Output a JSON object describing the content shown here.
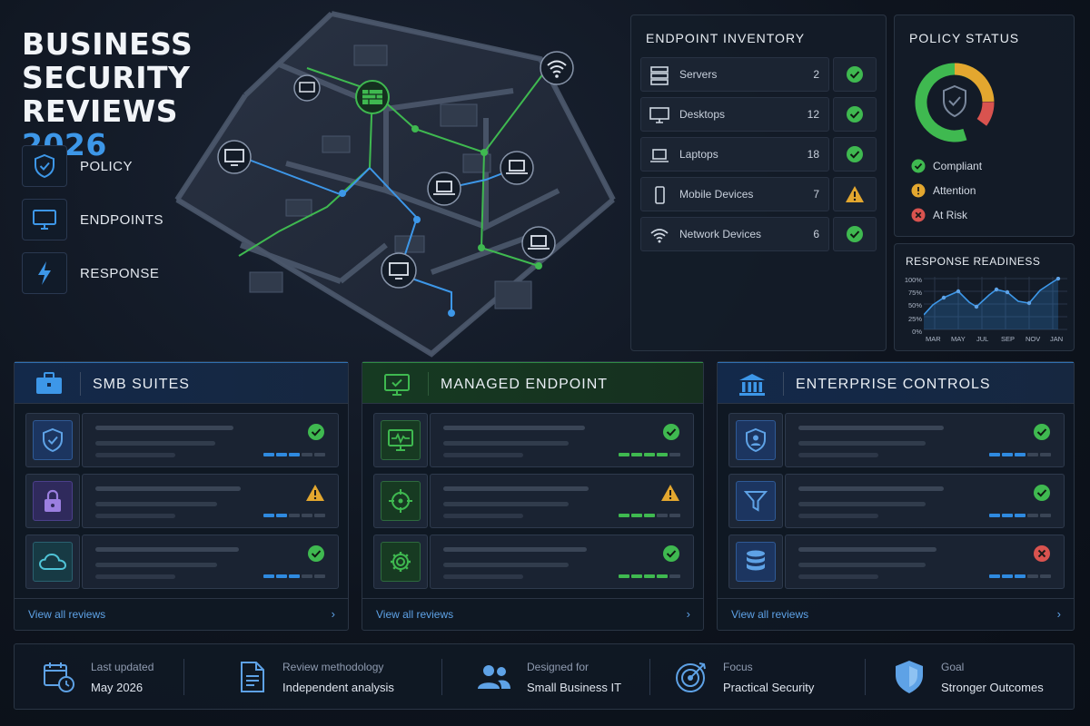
{
  "header": {
    "title_line1": "BUSINESS",
    "title_line2": "SECURITY",
    "title_line3": "REVIEWS",
    "title_year": "2026"
  },
  "pillars": [
    {
      "label": "POLICY",
      "icon": "shield-check-icon"
    },
    {
      "label": "ENDPOINTS",
      "icon": "monitor-icon"
    },
    {
      "label": "RESPONSE",
      "icon": "lightning-icon"
    }
  ],
  "inventory": {
    "title": "ENDPOINT INVENTORY",
    "items": [
      {
        "label": "Servers",
        "count": "2",
        "status": "ok",
        "icon": "server-icon"
      },
      {
        "label": "Desktops",
        "count": "12",
        "status": "ok",
        "icon": "monitor-icon"
      },
      {
        "label": "Laptops",
        "count": "18",
        "status": "ok",
        "icon": "laptop-icon"
      },
      {
        "label": "Mobile Devices",
        "count": "7",
        "status": "warning",
        "icon": "mobile-icon"
      },
      {
        "label": "Network Devices",
        "count": "6",
        "status": "ok",
        "icon": "wifi-icon"
      }
    ]
  },
  "policy_status": {
    "title": "POLICY STATUS",
    "legend": [
      {
        "label": "Compliant",
        "color": "#3fb950"
      },
      {
        "label": "Attention",
        "color": "#e3a72f"
      },
      {
        "label": "At Risk",
        "color": "#d9534f"
      }
    ]
  },
  "response_readiness": {
    "title": "RESPONSE READINESS",
    "yticks": [
      "100%",
      "75%",
      "50%",
      "25%",
      "0%"
    ],
    "xticks": [
      "MAR",
      "MAY",
      "JUL",
      "SEP",
      "NOV",
      "JAN"
    ]
  },
  "categories": [
    {
      "title": "SMB SUITES",
      "accent": "#2f8ae0",
      "icon": "briefcase-icon",
      "view_all": "View all reviews",
      "rows": [
        {
          "icon": "shield-check-icon",
          "status": "ok",
          "progress": 0.6
        },
        {
          "icon": "padlock-icon",
          "status": "warning",
          "progress": 0.4
        },
        {
          "icon": "cloud-icon",
          "status": "ok",
          "progress": 0.6
        }
      ]
    },
    {
      "title": "MANAGED ENDPOINT",
      "accent": "#3fb950",
      "icon": "monitor-check-icon",
      "view_all": "View all reviews",
      "rows": [
        {
          "icon": "monitor-pulse-icon",
          "status": "ok",
          "progress": 0.8
        },
        {
          "icon": "crosshair-icon",
          "status": "warning",
          "progress": 0.6
        },
        {
          "icon": "gear-icon",
          "status": "ok",
          "progress": 0.8
        }
      ]
    },
    {
      "title": "ENTERPRISE CONTROLS",
      "accent": "#2f8ae0",
      "icon": "bank-icon",
      "view_all": "View all reviews",
      "rows": [
        {
          "icon": "shield-user-icon",
          "status": "ok",
          "progress": 0.6
        },
        {
          "icon": "filter-icon",
          "status": "ok",
          "progress": 0.6
        },
        {
          "icon": "database-icon",
          "status": "risk",
          "progress": 0.6
        }
      ]
    }
  ],
  "footer": [
    {
      "key": "Last updated",
      "value": "May 2026",
      "icon": "calendar-clock-icon"
    },
    {
      "key": "Review methodology",
      "value": "Independent analysis",
      "icon": "document-icon"
    },
    {
      "key": "Designed for",
      "value": "Small Business IT",
      "icon": "users-icon"
    },
    {
      "key": "Focus",
      "value": "Practical Security",
      "icon": "target-icon"
    },
    {
      "key": "Goal",
      "value": "Stronger Outcomes",
      "icon": "shield-icon"
    }
  ]
}
